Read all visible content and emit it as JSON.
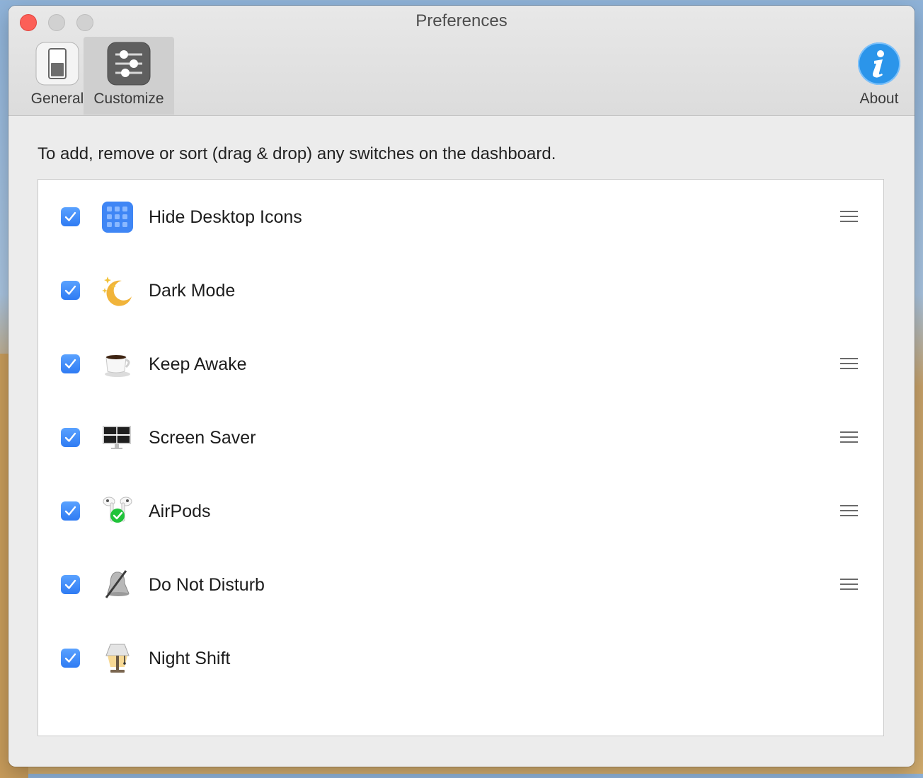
{
  "window": {
    "title": "Preferences"
  },
  "toolbar": {
    "tabs": [
      {
        "label": "General",
        "icon": "switch-icon"
      },
      {
        "label": "Customize",
        "icon": "sliders-icon",
        "selected": true
      },
      {
        "label": "About",
        "icon": "info-icon"
      }
    ]
  },
  "main": {
    "instruction": "To add, remove or sort (drag & drop) any switches on the dashboard.",
    "switches": [
      {
        "label": "Hide Desktop Icons",
        "checked": true,
        "icon": "desktop-grid-icon",
        "drag_handle": true
      },
      {
        "label": "Dark Mode",
        "checked": true,
        "icon": "moon-icon",
        "drag_handle": false
      },
      {
        "label": "Keep Awake",
        "checked": true,
        "icon": "coffee-cup-icon",
        "drag_handle": true
      },
      {
        "label": "Screen Saver",
        "checked": true,
        "icon": "monitor-icon",
        "drag_handle": true
      },
      {
        "label": "AirPods",
        "checked": true,
        "icon": "airpods-icon",
        "drag_handle": true
      },
      {
        "label": "Do Not Disturb",
        "checked": true,
        "icon": "muted-bell-icon",
        "drag_handle": true
      },
      {
        "label": "Night Shift",
        "checked": true,
        "icon": "lamp-icon",
        "drag_handle": false
      }
    ]
  },
  "colors": {
    "accent": "#3b86f7",
    "close": "#fc5f57",
    "about_icon": "#2b95ea"
  }
}
